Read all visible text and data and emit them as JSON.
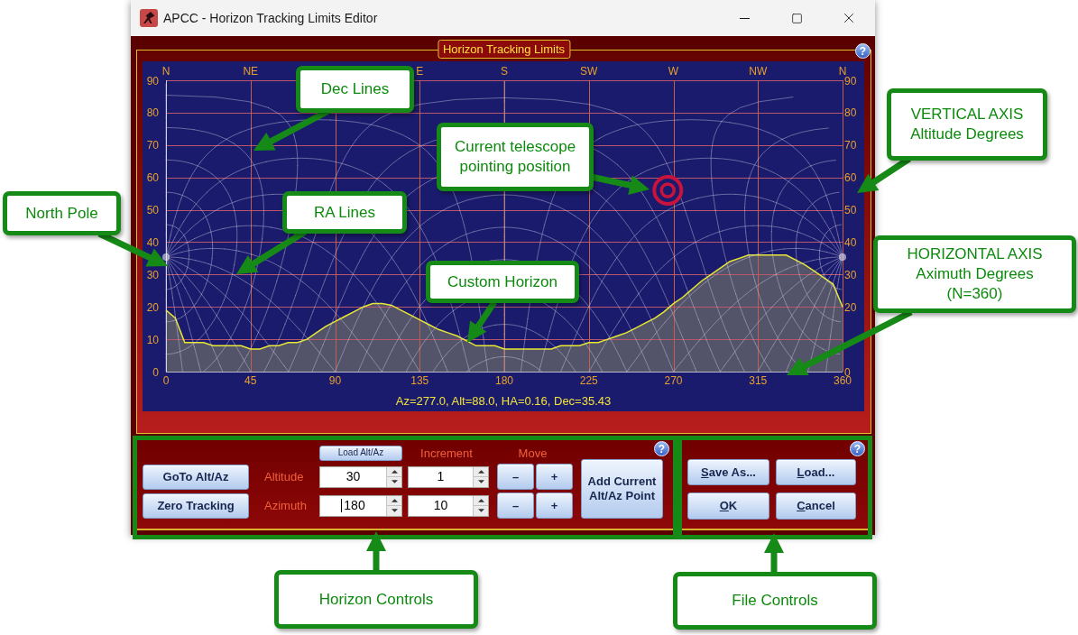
{
  "window": {
    "title": "APCC - Horizon Tracking Limits Editor"
  },
  "limits_panel": {
    "title": "Horizon Tracking Limits",
    "help": "?",
    "compass_labels": [
      "N",
      "NE",
      "E",
      "S",
      "SW",
      "W",
      "NW",
      "N"
    ],
    "chart_data": {
      "type": "area",
      "x": [
        0,
        5,
        10,
        15,
        20,
        25,
        30,
        35,
        40,
        45,
        50,
        55,
        60,
        65,
        70,
        75,
        80,
        85,
        90,
        95,
        100,
        105,
        110,
        115,
        120,
        125,
        130,
        135,
        140,
        145,
        150,
        155,
        160,
        165,
        170,
        175,
        180,
        185,
        190,
        195,
        200,
        205,
        210,
        215,
        220,
        225,
        230,
        235,
        240,
        245,
        250,
        255,
        260,
        265,
        270,
        275,
        280,
        285,
        290,
        295,
        300,
        305,
        310,
        315,
        320,
        325,
        330,
        335,
        340,
        345,
        350,
        355,
        360
      ],
      "series": [
        {
          "color": "#e8e832",
          "values": [
            19,
            16.5,
            9,
            9,
            9,
            8,
            8,
            8,
            8,
            7,
            7,
            8,
            8,
            9,
            9,
            10,
            12,
            14,
            15.5,
            17,
            18.5,
            20,
            21,
            21,
            20.5,
            19,
            17.5,
            16,
            14.5,
            13,
            12,
            11,
            9.5,
            8,
            8,
            8,
            7,
            7,
            7,
            7,
            7,
            7,
            8,
            8,
            8,
            9,
            9,
            10,
            11,
            12,
            13.5,
            15,
            16.5,
            18.5,
            21,
            23,
            25.5,
            28,
            30,
            32,
            34,
            35,
            36,
            36,
            36,
            36,
            36,
            34.5,
            33,
            31,
            29,
            27,
            20
          ]
        }
      ],
      "xlim": [
        0,
        360
      ],
      "ylim": [
        0,
        90
      ],
      "xticks": [
        0,
        45,
        90,
        135,
        180,
        225,
        270,
        315,
        360
      ],
      "yticks": [
        0,
        10,
        20,
        30,
        40,
        50,
        60,
        70,
        80,
        90
      ],
      "y2lim": [
        0,
        90
      ],
      "y2ticks": [
        0,
        20,
        30,
        40,
        50,
        60,
        70,
        80,
        90
      ],
      "grid": true
    },
    "status": "Az=277.0, Alt=88.0, HA=0.16, Dec=35.43"
  },
  "horizon_controls": {
    "help": "?",
    "load_button": "Load Alt/Az",
    "increment_label": "Increment",
    "move_label": "Move",
    "buttons": [
      "GoTo Alt/Az",
      "Zero Tracking"
    ],
    "rows": [
      {
        "label": "Altitude",
        "value": "30",
        "focused": false,
        "increment": "1",
        "minus": "–",
        "plus": "+"
      },
      {
        "label": "Azimuth",
        "value": "180",
        "focused": true,
        "increment": "10",
        "minus": "–",
        "plus": "+"
      }
    ],
    "add_button": "Add Current Alt/Az Point"
  },
  "file_controls": {
    "help": "?",
    "buttons": [
      {
        "label": "Save As...",
        "mnemonic": true
      },
      {
        "label": "Load...",
        "mnemonic": true
      },
      {
        "label": "OK",
        "mnemonic": true
      },
      {
        "label": "Cancel",
        "mnemonic": true
      }
    ]
  },
  "callouts": [
    {
      "lines": [
        "Dec Lines"
      ]
    },
    {
      "lines": [
        "Current telescope",
        "pointing position"
      ]
    },
    {
      "lines": [
        "North Pole"
      ]
    },
    {
      "lines": [
        "RA Lines"
      ]
    },
    {
      "lines": [
        "Custom Horizon"
      ]
    },
    {
      "lines": [
        "VERTICAL AXIS",
        "Altitude Degrees"
      ]
    },
    {
      "lines": [
        "HORIZONTAL AXIS",
        "Aximuth Degrees",
        "(N=360)"
      ]
    },
    {
      "lines": [
        "Horizon Controls"
      ]
    },
    {
      "lines": [
        "File Controls"
      ]
    }
  ]
}
